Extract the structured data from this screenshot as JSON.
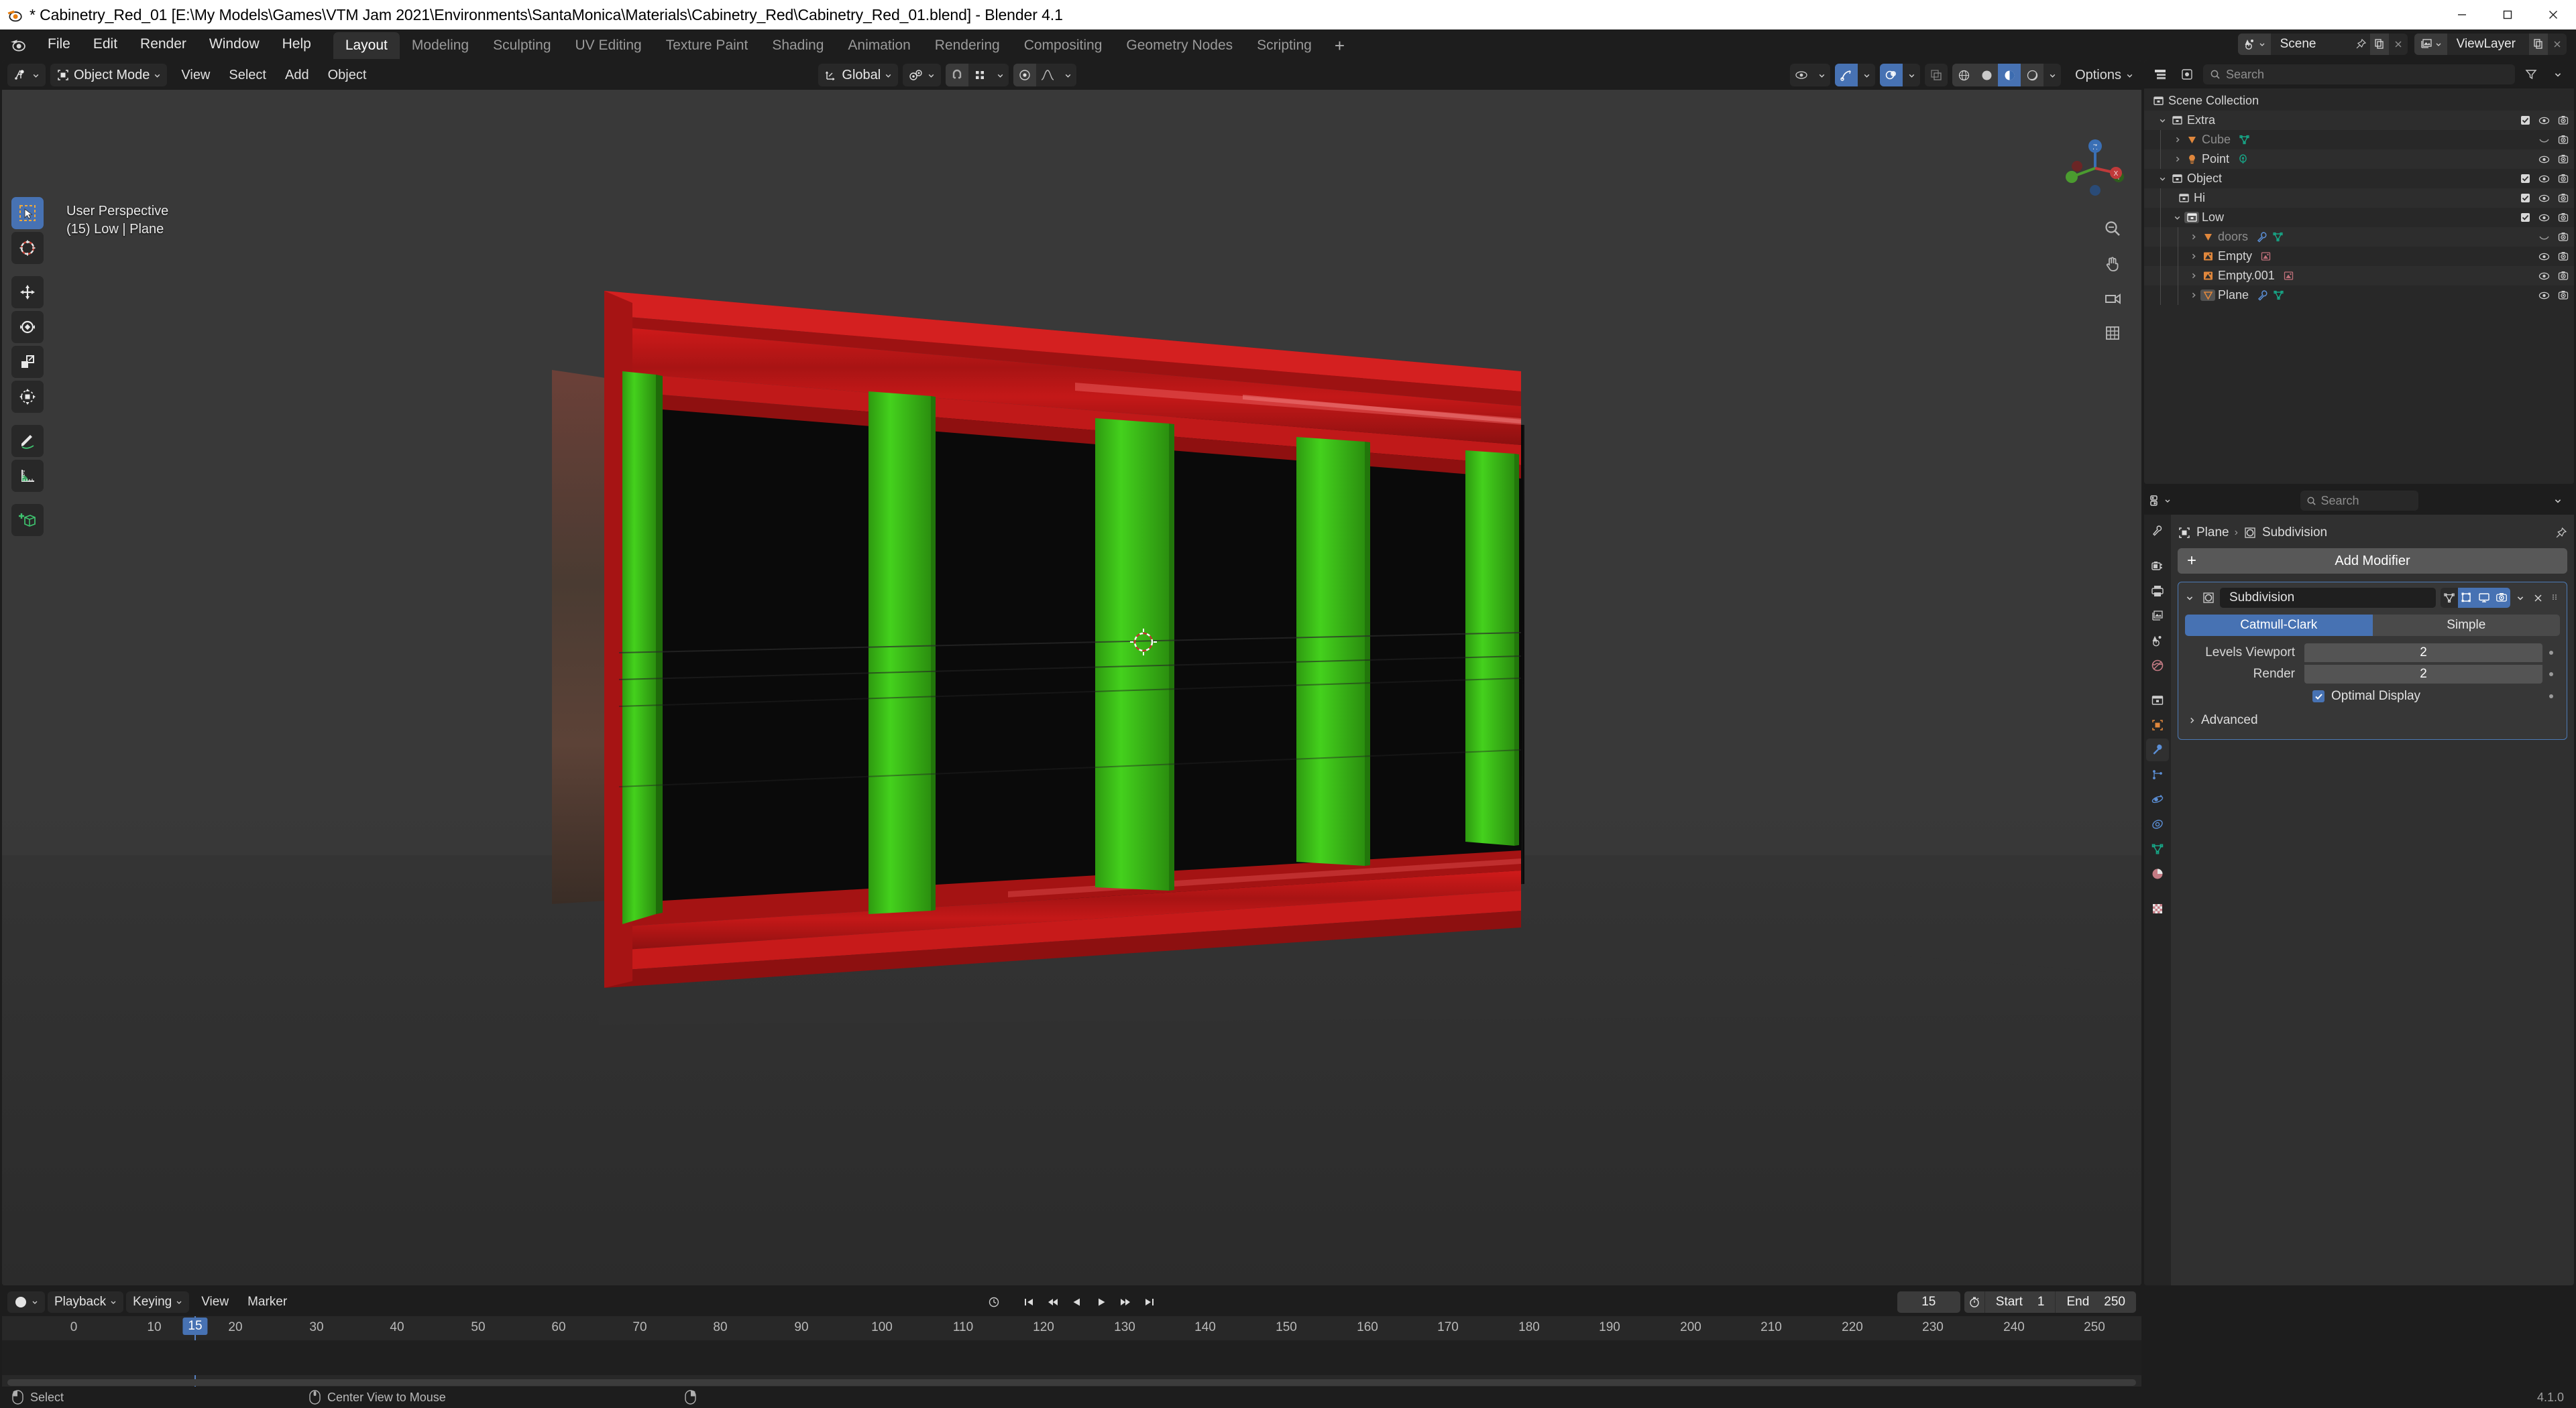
{
  "window": {
    "title": "* Cabinetry_Red_01 [E:\\My Models\\Games\\VTM Jam 2021\\Environments\\SantaMonica\\Materials\\Cabinetry_Red\\Cabinetry_Red_01.blend] - Blender 4.1",
    "minimize": "minimize-icon",
    "maximize": "maximize-icon",
    "close": "close-icon"
  },
  "topbar": {
    "logo": "blender-logo-icon",
    "menus": [
      "File",
      "Edit",
      "Render",
      "Window",
      "Help"
    ],
    "workspaces": [
      {
        "label": "Layout",
        "active": true
      },
      {
        "label": "Modeling",
        "active": false
      },
      {
        "label": "Sculpting",
        "active": false
      },
      {
        "label": "UV Editing",
        "active": false
      },
      {
        "label": "Texture Paint",
        "active": false
      },
      {
        "label": "Shading",
        "active": false
      },
      {
        "label": "Animation",
        "active": false
      },
      {
        "label": "Rendering",
        "active": false
      },
      {
        "label": "Compositing",
        "active": false
      },
      {
        "label": "Geometry Nodes",
        "active": false
      },
      {
        "label": "Scripting",
        "active": false
      }
    ],
    "add_workspace": "+",
    "scene": {
      "label": "Scene",
      "icon": "scene-icon"
    },
    "viewlayer": {
      "label": "ViewLayer",
      "icon": "viewlayer-icon"
    }
  },
  "viewport": {
    "editor_icon": "editor-type-3dview-icon",
    "mode": "Object Mode",
    "menus": [
      "View",
      "Select",
      "Add",
      "Object"
    ],
    "orientation": "Global",
    "snap_icon": "snap-magnet-icon",
    "proportional_icon": "proportional-edit-icon",
    "options_label": "Options",
    "overlay_line1": "User Perspective",
    "overlay_line2": "(15) Low | Plane",
    "tools": [
      "tweak-select-tool",
      "cursor-tool",
      "move-tool",
      "rotate-tool",
      "scale-tool",
      "transform-tool",
      "annotate-tool",
      "measure-tool",
      "add-cube-tool"
    ],
    "nav_buttons": [
      "zoom-icon",
      "pan-hand-icon",
      "camera-view-icon",
      "toggle-ortho-icon"
    ]
  },
  "outliner": {
    "display_mode_icon": "outliner-display-mode-icon",
    "filter_icon": "filter-icon",
    "search_placeholder": "Search",
    "rows": [
      {
        "label": "Scene Collection",
        "icon": "collection-icon",
        "depth": 0,
        "disclosure": "none",
        "datas": [],
        "checkbox": false,
        "eye": false,
        "camera": false
      },
      {
        "label": "Extra",
        "icon": "collection-icon",
        "depth": 1,
        "disclosure": "open",
        "datas": [],
        "checkbox": true,
        "eye": true,
        "camera": true
      },
      {
        "label": "Cube",
        "icon": "mesh-object-icon",
        "depth": 2,
        "disclosure": "closed",
        "dim": true,
        "datas": [
          "mesh-data-icon"
        ],
        "checkbox": false,
        "eye": "hidden",
        "camera": true
      },
      {
        "label": "Point",
        "icon": "light-object-icon",
        "depth": 2,
        "disclosure": "closed",
        "datas": [
          "light-data-icon"
        ],
        "checkbox": false,
        "eye": true,
        "camera": true
      },
      {
        "label": "Object",
        "icon": "collection-icon",
        "depth": 1,
        "disclosure": "open",
        "datas": [],
        "checkbox": true,
        "eye": true,
        "camera": true
      },
      {
        "label": "Hi",
        "icon": "collection-icon",
        "depth": 2,
        "disclosure": "none",
        "datas": [],
        "checkbox": true,
        "eye": true,
        "camera": true
      },
      {
        "label": "Low",
        "icon": "collection-icon",
        "depth": 2,
        "disclosure": "open",
        "highlight": true,
        "datas": [],
        "checkbox": true,
        "eye": true,
        "camera": true
      },
      {
        "label": "doors",
        "icon": "mesh-object-icon",
        "depth": 3,
        "disclosure": "closed",
        "dim": true,
        "datas": [
          "modifier-wrench-icon",
          "mesh-data-icon"
        ],
        "checkbox": false,
        "eye": "hidden",
        "camera": true
      },
      {
        "label": "Empty",
        "icon": "empty-image-object-icon",
        "depth": 3,
        "disclosure": "closed",
        "datas": [
          "image-data-icon"
        ],
        "checkbox": false,
        "eye": true,
        "camera": true
      },
      {
        "label": "Empty.001",
        "icon": "empty-image-object-icon",
        "depth": 3,
        "disclosure": "closed",
        "datas": [
          "image-data-icon"
        ],
        "checkbox": false,
        "eye": true,
        "camera": true
      },
      {
        "label": "Plane",
        "icon": "mesh-object-icon",
        "depth": 3,
        "disclosure": "closed",
        "selected": true,
        "datas": [
          "modifier-wrench-icon",
          "mesh-data-icon"
        ],
        "checkbox": false,
        "eye": true,
        "camera": true
      }
    ]
  },
  "properties": {
    "editor_icon": "editor-type-properties-icon",
    "search_placeholder": "Search",
    "expand_icon": "chevron-down-icon",
    "tabs": [
      "tool-icon",
      "render-icon",
      "output-icon",
      "viewlayer-icon",
      "scene-icon",
      "world-icon",
      "collection-icon",
      "object-icon",
      "modifier-wrench-icon",
      "particles-icon",
      "physics-icon",
      "constraints-icon",
      "data-mesh-icon",
      "material-icon",
      "texture-icon"
    ],
    "active_tab_index": 8,
    "breadcrumb": {
      "object": "Plane",
      "modifier": "Subdivision"
    },
    "add_modifier_label": "Add Modifier",
    "modifier": {
      "name": "Subdivision",
      "toggles": [
        "on-cage-icon",
        "edit-mode-icon",
        "realtime-display-icon",
        "render-icon"
      ],
      "toggle_states": [
        false,
        true,
        true,
        true
      ],
      "dropdown_icon": "chevron-down-icon",
      "close_icon": "x-close-icon",
      "drag_icon": "drag-grip-icon",
      "subdivision_type": [
        "Catmull-Clark",
        "Simple"
      ],
      "subdivision_type_active": "Catmull-Clark",
      "fields": [
        {
          "label": "Levels Viewport",
          "value": "2"
        },
        {
          "label": "Render",
          "value": "2"
        }
      ],
      "optimal_display": {
        "label": "Optimal Display",
        "checked": true
      },
      "advanced_label": "Advanced"
    }
  },
  "timeline": {
    "editor_icon": "editor-type-timeline-icon",
    "menus": [
      "Playback",
      "Keying",
      "View",
      "Marker"
    ],
    "transport": [
      "jump-start-icon",
      "prev-keyframe-icon",
      "play-reverse-icon",
      "play-icon",
      "next-keyframe-icon",
      "jump-end-icon"
    ],
    "sync_icon": "sync-icon",
    "current_frame": "15",
    "frame_range_icon": "stopwatch-icon",
    "start_label": "Start",
    "start_value": "1",
    "end_label": "End",
    "end_value": "250",
    "ticks": [
      0,
      10,
      15,
      20,
      30,
      40,
      50,
      60,
      70,
      80,
      90,
      100,
      110,
      120,
      130,
      140,
      150,
      160,
      170,
      180,
      190,
      200,
      210,
      220,
      230,
      240,
      250
    ],
    "playhead_frame": 15
  },
  "statusbar": {
    "items": [
      {
        "icon": "mouse-left-icon",
        "label": "Select"
      },
      {
        "icon": "mouse-middle-icon",
        "label": "Center View to Mouse"
      },
      {
        "icon": "mouse-right-icon",
        "label": ""
      }
    ],
    "version": "4.1.0"
  },
  "colors": {
    "accent_blue": "#4772b3",
    "bg_dark": "#1d1d1d",
    "panel": "#303030",
    "body": "#282828",
    "cabinet_red": "#b41414",
    "cabinet_green": "#3ec218"
  }
}
